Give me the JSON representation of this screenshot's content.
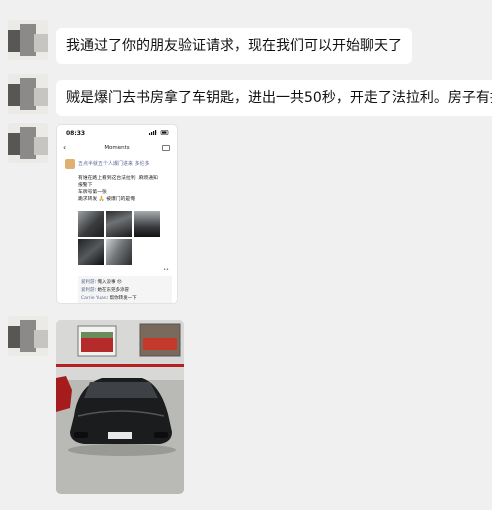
{
  "messages": [
    {
      "id": "m1",
      "text": "我通过了你的朋友验证请求，现在我们可以开始聊天了"
    },
    {
      "id": "m2",
      "text": "贼是爆门去书房拿了车钥匙，进出一共50秒，开走了法拉利。房子有担"
    }
  ],
  "moments": {
    "time": "08:33",
    "title": "Moments",
    "poster_name": "五点半就五个人爆门进来  多伦多",
    "post_text_lines": [
      "有谁在路上看到这台法拉利 ‍‍‍‍  麻烦通知",
      "报警下",
      "车牌号第一张",
      "跪求转发 🙏 被爆门的是俺"
    ],
    "comments": [
      {
        "who": "爱利游",
        "text": "俺入没事 😞"
      },
      {
        "who": "爱利游",
        "text": "她在东莞多添冒"
      },
      {
        "who": "Carrie Yuan",
        "text": "帮你转发一下"
      }
    ]
  },
  "colors": {
    "background": "#f0f0f0",
    "bubble": "#ffffff",
    "link": "#576b95"
  }
}
